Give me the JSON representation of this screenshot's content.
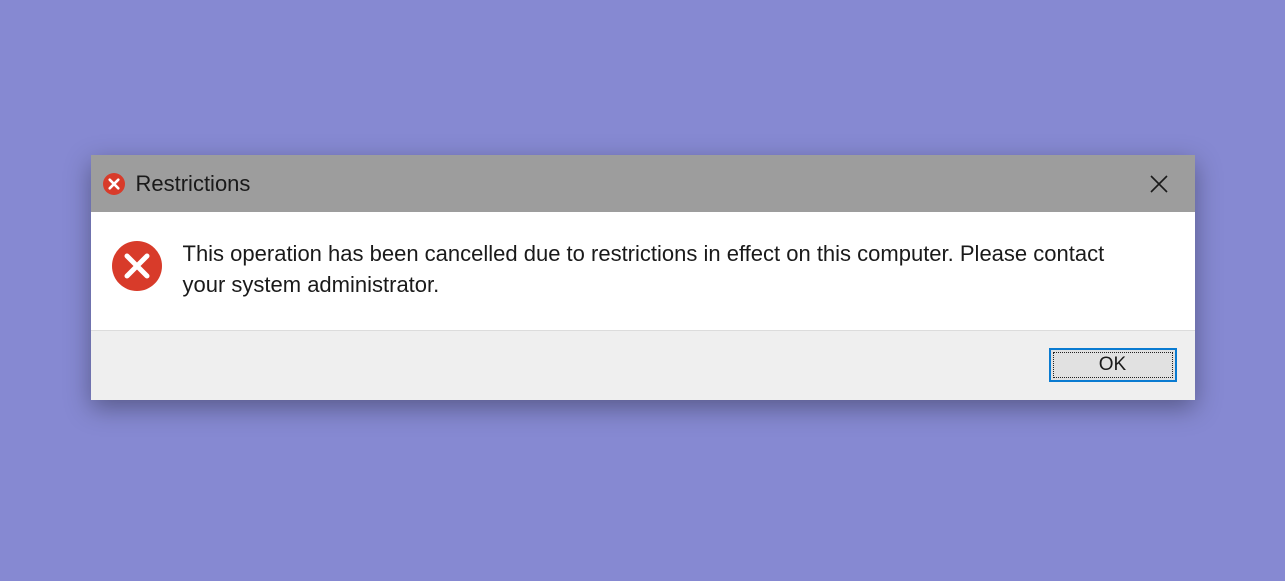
{
  "dialog": {
    "title": "Restrictions",
    "message": "This operation has been cancelled due to restrictions in effect on this computer. Please contact your system administrator.",
    "ok_label": "OK",
    "icon": "error-icon",
    "colors": {
      "error_red": "#d83b2a",
      "titlebar_bg": "#9d9d9d",
      "footer_bg": "#efefef",
      "button_border": "#0a7bd1"
    }
  }
}
